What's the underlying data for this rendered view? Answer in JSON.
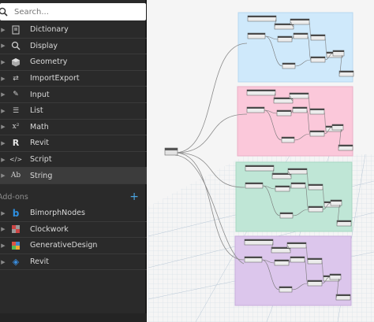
{
  "search": {
    "placeholder": "Search..."
  },
  "library": {
    "items": [
      {
        "label": "Dictionary",
        "icon": "dictionary-icon"
      },
      {
        "label": "Display",
        "icon": "search-icon"
      },
      {
        "label": "Geometry",
        "icon": "cube-icon"
      },
      {
        "label": "ImportExport",
        "icon": "import-export-icon"
      },
      {
        "label": "Input",
        "icon": "pencil-icon"
      },
      {
        "label": "List",
        "icon": "list-icon"
      },
      {
        "label": "Math",
        "icon": "math-icon"
      },
      {
        "label": "Revit",
        "icon": "revit-icon"
      },
      {
        "label": "Script",
        "icon": "code-icon"
      },
      {
        "label": "String",
        "icon": "string-icon"
      }
    ],
    "addons_label": "Add-ons",
    "addons": [
      {
        "label": "BimorphNodes",
        "icon": "bimorph-icon"
      },
      {
        "label": "Clockwork",
        "icon": "clockwork-icon"
      },
      {
        "label": "GenerativeDesign",
        "icon": "generative-design-icon"
      },
      {
        "label": "Revit",
        "icon": "revit-addon-icon"
      }
    ]
  },
  "groups": [
    {
      "color": "#cfe9fb"
    },
    {
      "color": "#fbc8da"
    },
    {
      "color": "#bfe6d6"
    },
    {
      "color": "#dcc6ec"
    }
  ],
  "colors": {
    "accent": "#4aa3df",
    "panel": "#2a2a2a"
  }
}
